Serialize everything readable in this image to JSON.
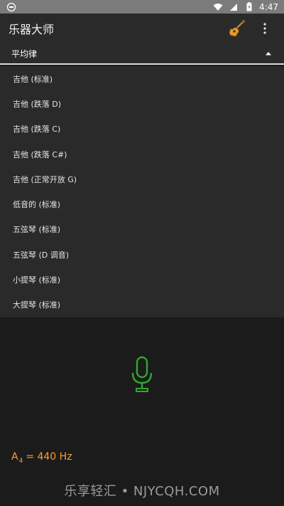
{
  "status_bar": {
    "time": "4:47",
    "icons": [
      "notification-icon",
      "wifi-icon",
      "signal-icon",
      "battery-icon"
    ]
  },
  "toolbar": {
    "title": "乐器大师",
    "instrument_icon": "guitar-icon",
    "overflow_icon": "more-vert-icon"
  },
  "temperament": {
    "selected": "平均律"
  },
  "tunings": [
    "吉他 (标准)",
    "吉他 (跌落 D)",
    "吉他 (跌落 C)",
    "吉他 (跌落 C#)",
    "吉他 (正常开放 G)",
    "低音的 (标准)",
    "五弦琴 (标准)",
    "五弦琴 (D 调音)",
    "小提琴 (标准)",
    "大提琴 (标准)"
  ],
  "tuner": {
    "mic_icon": "microphone-icon",
    "reference_note": "A",
    "reference_octave": "4",
    "reference_value": "= 440 Hz"
  },
  "watermark": "乐享轻汇 • NJYCQH.COM",
  "colors": {
    "accent_orange": "#ff9d2e",
    "mic_green": "#2fa82f",
    "list_bg": "#2a2a2a",
    "main_bg": "#1b1b1b"
  }
}
